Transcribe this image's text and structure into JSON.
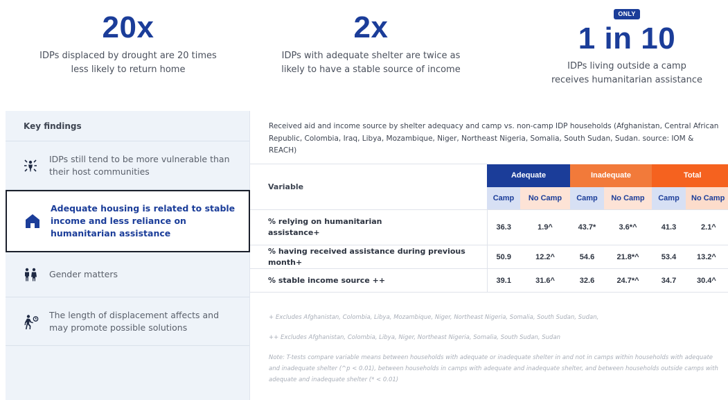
{
  "stats": [
    {
      "big": "20x",
      "badge": "",
      "desc_line1": "IDPs displaced by drought are 20 times",
      "desc_line2": "less likely to return home"
    },
    {
      "big": "2x",
      "badge": "",
      "desc_line1": "IDPs with adequate shelter are twice as",
      "desc_line2": "likely to have a stable source of income"
    },
    {
      "big": "1 in 10",
      "badge": "ONLY",
      "desc_line1": "IDPs living outside a camp",
      "desc_line2": "receives humanitarian assistance"
    }
  ],
  "sidebar": {
    "title": "Key findings",
    "items": [
      {
        "label": "IDPs still tend to be more vulnerable than their host communities",
        "icon": "people-burst-icon"
      },
      {
        "label": "Adequate housing is related to stable income and less reliance on humanitarian assistance",
        "icon": "house-icon",
        "active": true
      },
      {
        "label": "Gender matters",
        "icon": "gender-people-icon"
      },
      {
        "label": "The length of displacement affects and may promote possible solutions",
        "icon": "person-clock-icon"
      }
    ]
  },
  "caption": "Received aid and income source by shelter adequacy and camp vs. non-camp IDP households (Afghanistan, Central African Republic, Colombia, Iraq, Libya, Mozambique, Niger, Northeast Nigeria, Somalia, South Sudan, Sudan. source: IOM & REACH)",
  "table": {
    "variable_header": "Variable",
    "groups": [
      "Adequate",
      "Inadequate",
      "Total"
    ],
    "subheaders": [
      "Camp",
      "No Camp",
      "Camp",
      "No Camp",
      "Camp",
      "No Camp"
    ],
    "rows": [
      {
        "label": "% relying on humanitarian assistance+",
        "values": [
          "36.3",
          "1.9^",
          "43.7*",
          "3.6*^",
          "41.3",
          "2.1^"
        ]
      },
      {
        "label": "% having received assistance during previous month+",
        "values": [
          "50.9",
          "12.2^",
          "54.6",
          "21.8*^",
          "53.4",
          "13.2^"
        ]
      },
      {
        "label": "% stable income source ++",
        "values": [
          "39.1",
          "31.6^",
          "32.6",
          "24.7*^",
          "34.7",
          "30.4^"
        ]
      }
    ]
  },
  "notes": {
    "n1": "+ Excludes Afghanistan, Colombia, Libya, Mozambique, Niger, Northeast Nigeria, Somalia, South Sudan, Sudan,",
    "n2": "++ Excludes Afghanistan, Colombia, Libya, Niger, Northeast Nigeria, Somalia, South Sudan, Sudan",
    "n3": "Note: T-tests compare variable means between households with adequate or inadequate shelter in and not in camps within households with adequate and inadequate shelter (^p < 0.01), between households in camps with adequate and inadequate shelter, and between households outside camps with adequate and inadequate shelter (* < 0.01)"
  },
  "colors": {
    "brand_blue": "#1b3d99",
    "orange": "#f27a3a",
    "orange_dark": "#f5621f",
    "sidebar_bg": "#eef3f9"
  }
}
